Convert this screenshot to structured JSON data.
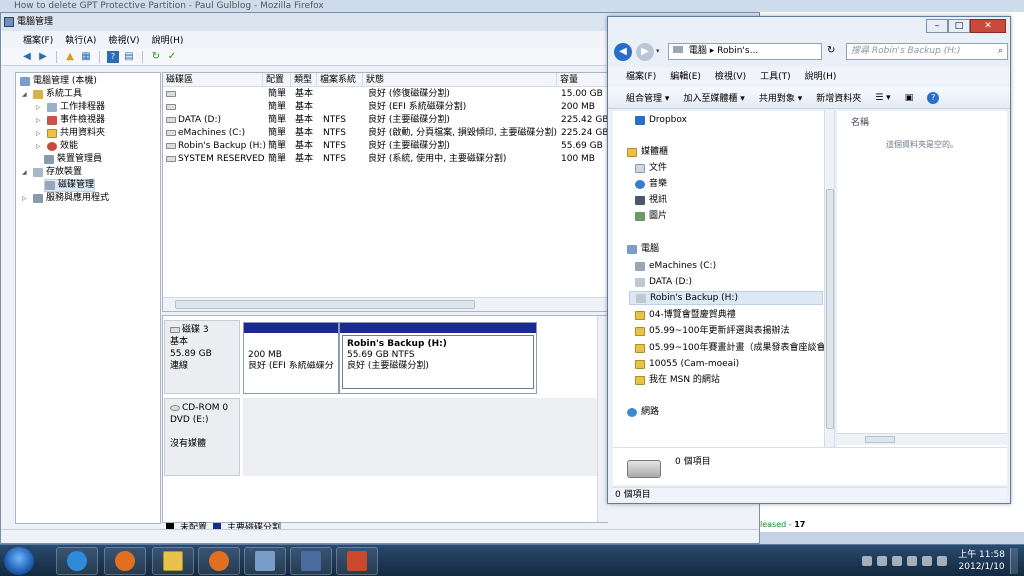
{
  "firefox": {
    "title": "How to delete GPT Protective Partition - Paul Gulblog - Mozilla Firefox",
    "footer_prefix": "leased - ",
    "footer_count": "17"
  },
  "cm": {
    "title": "電腦管理",
    "menu": [
      "檔案(F)",
      "執行(A)",
      "檢視(V)",
      "說明(H)"
    ],
    "tree": [
      {
        "label": "電腦管理 (本機)",
        "level": 0
      },
      {
        "label": "系統工具",
        "level": 1
      },
      {
        "label": "工作排程器",
        "level": 2
      },
      {
        "label": "事件檢視器",
        "level": 2
      },
      {
        "label": "共用資料夾",
        "level": 2
      },
      {
        "label": "效能",
        "level": 2
      },
      {
        "label": "裝置管理員",
        "level": 2
      },
      {
        "label": "存放裝置",
        "level": 1
      },
      {
        "label": "磁碟管理",
        "level": 2
      },
      {
        "label": "服務與應用程式",
        "level": 1
      }
    ],
    "columns": [
      "磁碟區",
      "配置",
      "類型",
      "檔案系統",
      "狀態",
      "容量"
    ],
    "volumes": [
      {
        "name": "",
        "layout": "簡單",
        "type": "基本",
        "fs": "",
        "status": "良好 (修復磁碟分割)",
        "cap": "15.00 GB"
      },
      {
        "name": "",
        "layout": "簡單",
        "type": "基本",
        "fs": "",
        "status": "良好 (EFI 系統磁碟分割)",
        "cap": "200 MB"
      },
      {
        "name": "DATA (D:)",
        "layout": "簡單",
        "type": "基本",
        "fs": "NTFS",
        "status": "良好 (主要磁碟分割)",
        "cap": "225.42 GB"
      },
      {
        "name": "eMachines (C:)",
        "layout": "簡單",
        "type": "基本",
        "fs": "NTFS",
        "status": "良好 (啟動, 分頁檔案, 損毀傾印, 主要磁碟分割)",
        "cap": "225.24 GB"
      },
      {
        "name": "Robin's Backup (H:)",
        "layout": "簡單",
        "type": "基本",
        "fs": "NTFS",
        "status": "良好 (主要磁碟分割)",
        "cap": "55.69 GB"
      },
      {
        "name": "SYSTEM RESERVED",
        "layout": "簡單",
        "type": "基本",
        "fs": "NTFS",
        "status": "良好 (系統, 使用中, 主要磁碟分割)",
        "cap": "100 MB"
      }
    ],
    "disk3": {
      "name": "磁碟 3",
      "type": "基本",
      "size": "55.89 GB",
      "state": "連線"
    },
    "part1": {
      "size": "200 MB",
      "status": "良好 (EFI 系統磁碟分"
    },
    "part2": {
      "name": "Robin's Backup  (H:)",
      "size": "55.69 GB NTFS",
      "status": "良好 (主要磁碟分割)"
    },
    "cdrom": {
      "name": "CD-ROM 0",
      "drive": "DVD (E:)",
      "media": "沒有媒體"
    },
    "legend": {
      "unallocated": "未配置",
      "primary": "主要磁碟分割"
    }
  },
  "explorer": {
    "address": [
      "電腦",
      "Robin's..."
    ],
    "search_placeholder": "搜尋 Robin's Backup (H:)",
    "menu": [
      "檔案(F)",
      "編輯(E)",
      "檢視(V)",
      "工具(T)",
      "說明(H)"
    ],
    "commands": [
      "組合管理",
      "加入至媒體櫃",
      "共用對象",
      "新增資料夾"
    ],
    "nav": [
      {
        "label": "Dropbox",
        "kind": "dropbox"
      },
      {
        "label": "媒體櫃",
        "kind": "library"
      },
      {
        "label": "文件",
        "kind": "doc"
      },
      {
        "label": "音樂",
        "kind": "music"
      },
      {
        "label": "視訊",
        "kind": "video"
      },
      {
        "label": "圖片",
        "kind": "pic"
      },
      {
        "label": "電腦",
        "kind": "computer"
      },
      {
        "label": "eMachines (C:)",
        "kind": "drive"
      },
      {
        "label": "DATA (D:)",
        "kind": "drive"
      },
      {
        "label": "Robin's Backup (H:)",
        "kind": "drive"
      },
      {
        "label": "04-博覽會暨慶賀典禮",
        "kind": "folder"
      },
      {
        "label": "05.99~100年更新評選與表揚辦法",
        "kind": "folder"
      },
      {
        "label": "05.99~100年賽畫計畫（成果發表會座談會",
        "kind": "folder"
      },
      {
        "label": "10055 (Cam-moeai)",
        "kind": "folder"
      },
      {
        "label": "我在 MSN 的網站",
        "kind": "folder"
      },
      {
        "label": "網路",
        "kind": "network"
      }
    ],
    "column_name": "名稱",
    "empty_text": "這個資料夾是空的。",
    "details_items": "0 個項目",
    "status": "0 個項目"
  },
  "taskbar": {
    "time": "上午 11:58",
    "date": "2012/1/10"
  }
}
